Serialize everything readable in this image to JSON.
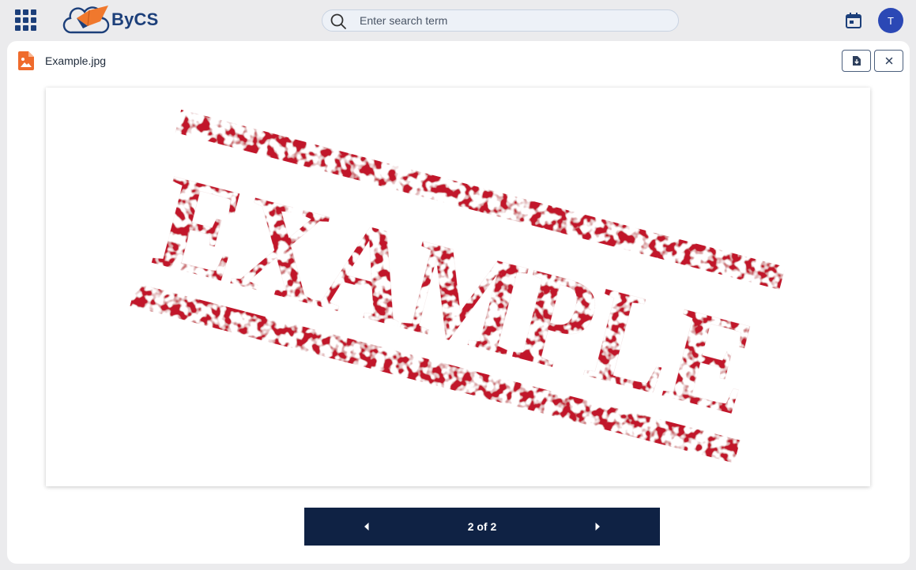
{
  "app": {
    "name": "ByCS"
  },
  "search": {
    "placeholder": "Enter search term"
  },
  "user": {
    "initial": "T"
  },
  "file": {
    "name": "Example.jpg",
    "image_stamp_text": "EXAMPLE"
  },
  "pager": {
    "status": "2 of 2"
  },
  "colors": {
    "brand_navy": "#1c3f7a",
    "brand_orange": "#f0782d",
    "avatar": "#2b48b5",
    "pager_bg": "#0f2244",
    "stamp_red": "#c1142b",
    "file_icon": "#ef6b2c"
  },
  "icons": {
    "apps": "grid-icon",
    "search": "search-icon",
    "calendar": "calendar-icon",
    "file": "image-file-icon",
    "download": "download-icon",
    "close": "close-icon",
    "prev": "caret-left-icon",
    "next": "caret-right-icon"
  }
}
